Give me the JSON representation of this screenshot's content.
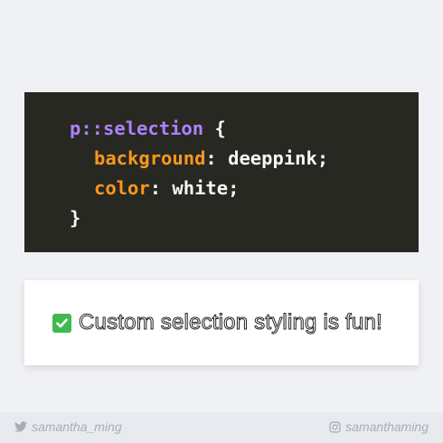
{
  "code": {
    "selector": "p::selection",
    "open_brace": " {",
    "line1_prop": "background",
    "line1_sep": ": ",
    "line1_value": "deeppink;",
    "line2_prop": "color",
    "line2_sep": ": ",
    "line2_value": "white;",
    "close_brace": "}"
  },
  "demo": {
    "icon": "check-mark-button-icon",
    "text": "Custom selection styling is fun!"
  },
  "footer": {
    "twitter_icon": "twitter-icon",
    "twitter_handle": "samantha_ming",
    "instagram_icon": "instagram-icon",
    "instagram_handle": "samanthaming"
  },
  "colors": {
    "code_background": "#272822",
    "selector": "#ae81ff",
    "property": "#fd971f",
    "check": "#3fb950",
    "page_background": "#f0f1f4"
  }
}
